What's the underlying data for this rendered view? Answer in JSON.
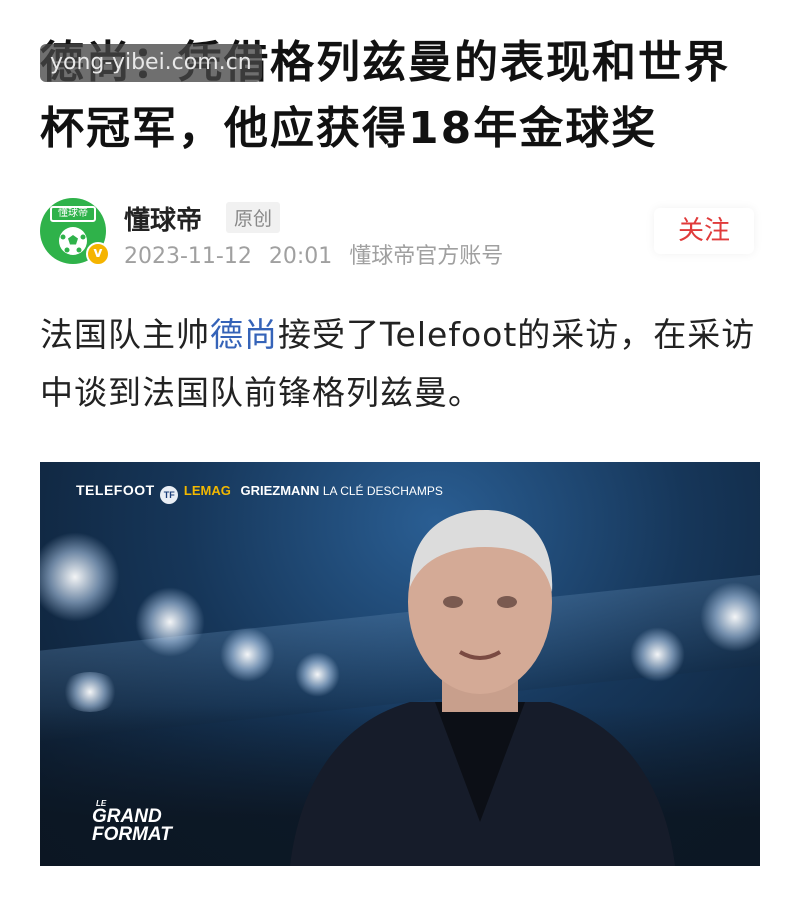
{
  "watermark": "yong-yibei.com.cn",
  "article": {
    "title": "德尚：凭借格列兹曼的表现和世界杯冠军，他应获得18年金球奖"
  },
  "author": {
    "avatar_label": "懂球帝",
    "name": "懂球帝",
    "badge": "原创",
    "date": "2023-11-12",
    "time": "20:01",
    "account": "懂球帝官方账号",
    "follow_label": "关注"
  },
  "body": {
    "part1": "法国队主帅",
    "link": "德尚",
    "part2": "接受了Telefoot的采访，在采访中谈到法国队前锋格列兹曼。"
  },
  "video": {
    "brand": "TELEFOOT",
    "logo": "TF",
    "lemag": "LEMAG",
    "subtitle_bold": "GRIEZMANN",
    "subtitle": "LA CLÉ DESCHAMPS",
    "grand_le": "LE",
    "grand_1": "GRAND",
    "grand_2": "FORMAT"
  },
  "colors": {
    "link": "#3563b8",
    "follow": "#e03b3b",
    "avatar_bg": "#2fb24a",
    "verified": "#f5b400"
  },
  "icons": {
    "avatar": "football-logo-icon",
    "verified": "verified-v-icon"
  }
}
